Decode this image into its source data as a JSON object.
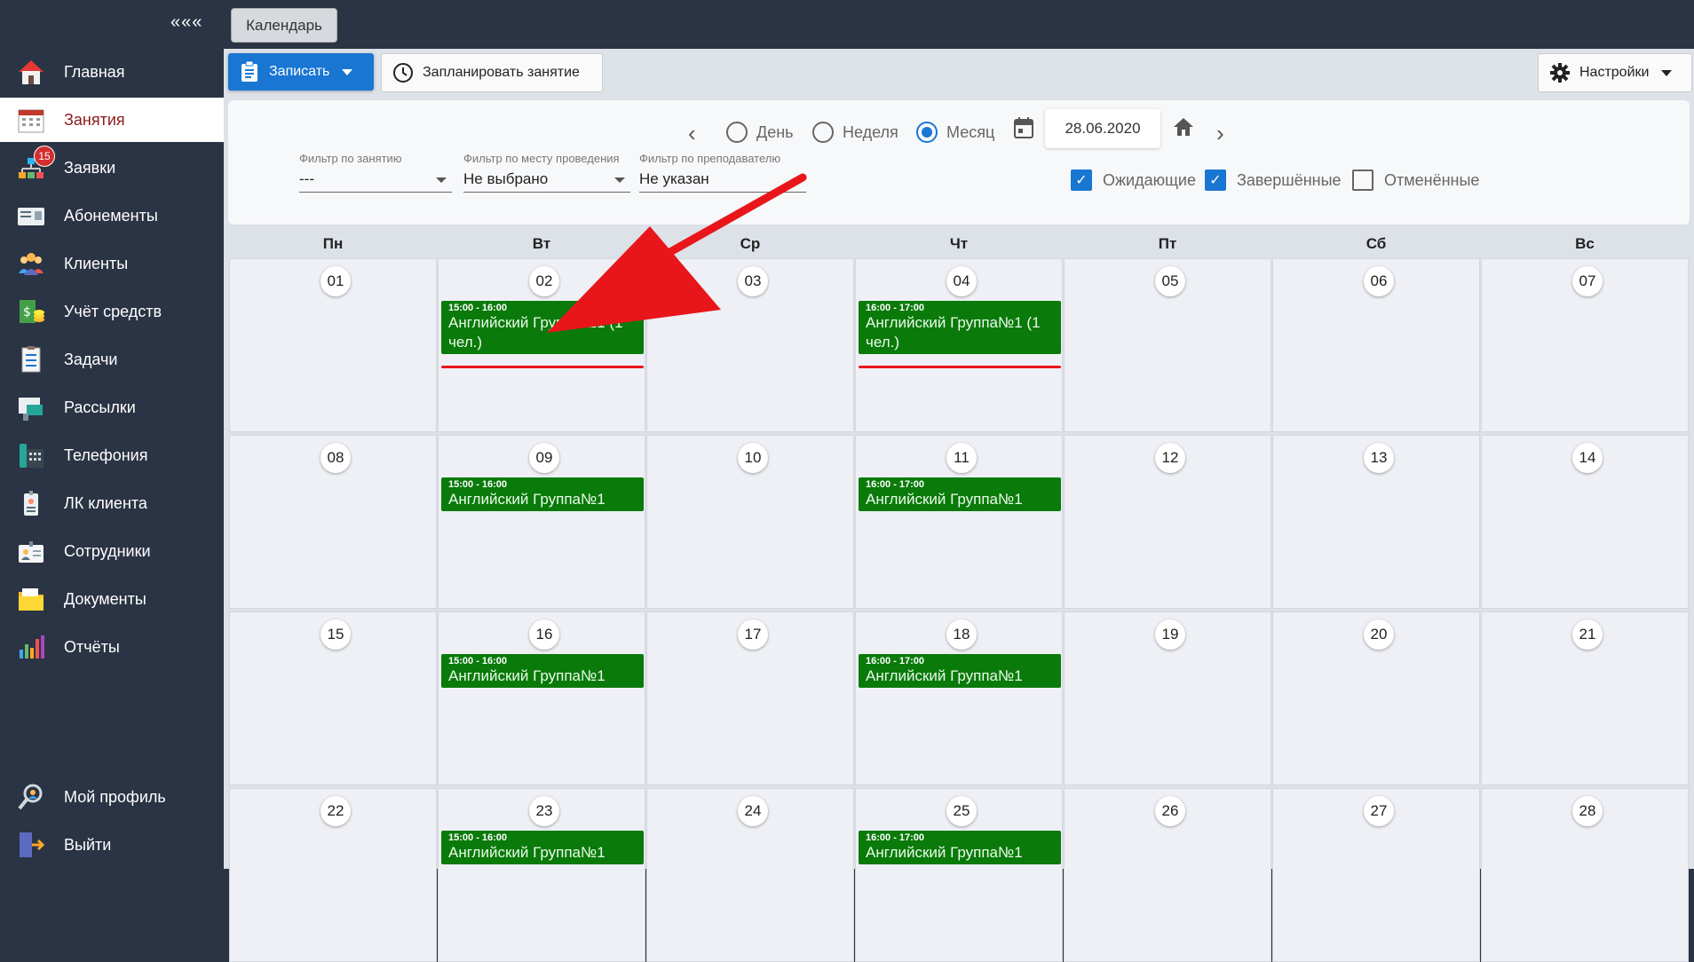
{
  "sidebar": {
    "collapse_label": "«««",
    "items": [
      {
        "label": "Главная",
        "icon": "home-icon"
      },
      {
        "label": "Занятия",
        "icon": "calendar-icon",
        "active": true
      },
      {
        "label": "Заявки",
        "icon": "requests-icon",
        "badge": "15"
      },
      {
        "label": "Абонементы",
        "icon": "subscription-card-icon"
      },
      {
        "label": "Клиенты",
        "icon": "clients-icon"
      },
      {
        "label": "Учёт средств",
        "icon": "money-icon"
      },
      {
        "label": "Задачи",
        "icon": "tasks-icon"
      },
      {
        "label": "Рассылки",
        "icon": "mailing-icon"
      },
      {
        "label": "Телефония",
        "icon": "phone-icon"
      },
      {
        "label": "ЛК клиента",
        "icon": "client-badge-icon"
      },
      {
        "label": "Сотрудники",
        "icon": "staff-icon"
      },
      {
        "label": "Документы",
        "icon": "documents-icon"
      },
      {
        "label": "Отчёты",
        "icon": "reports-icon"
      }
    ],
    "bottom_items": [
      {
        "label": "Мой профиль",
        "icon": "profile-icon"
      },
      {
        "label": "Выйти",
        "icon": "logout-icon"
      }
    ]
  },
  "topbar": {
    "tab_label": "Календарь"
  },
  "actions": {
    "write_label": "Записать",
    "plan_label": "Запланировать занятие",
    "settings_label": "Настройки"
  },
  "view": {
    "modes": [
      {
        "label": "День",
        "selected": false
      },
      {
        "label": "Неделя",
        "selected": false
      },
      {
        "label": "Месяц",
        "selected": true
      }
    ],
    "date": "28.06.2020"
  },
  "filters": [
    {
      "label": "Фильтр по занятию",
      "value": "---"
    },
    {
      "label": "Фильтр по месту проведения",
      "value": "Не выбрано"
    },
    {
      "label": "Фильтр по преподавателю",
      "value": "Не указан"
    }
  ],
  "status_checks": [
    {
      "label": "Ожидающие",
      "checked": true
    },
    {
      "label": "Завершённые",
      "checked": true
    },
    {
      "label": "Отменённые",
      "checked": false
    }
  ],
  "calendar": {
    "weekdays": [
      "Пн",
      "Вт",
      "Ср",
      "Чт",
      "Пт",
      "Сб",
      "Вс"
    ],
    "weeks": [
      [
        "01",
        "02",
        "03",
        "04",
        "05",
        "06",
        "07"
      ],
      [
        "08",
        "09",
        "10",
        "11",
        "12",
        "13",
        "14"
      ],
      [
        "15",
        "16",
        "17",
        "18",
        "19",
        "20",
        "21"
      ],
      [
        "22",
        "23",
        "24",
        "25",
        "26",
        "27",
        "28"
      ]
    ],
    "events": [
      {
        "week": 0,
        "day": 1,
        "time": "15:00 - 16:00",
        "title": "Английский Группа№1 (1 чел.)"
      },
      {
        "week": 0,
        "day": 3,
        "time": "16:00 - 17:00",
        "title": "Английский Группа№1 (1 чел.)"
      },
      {
        "week": 1,
        "day": 1,
        "time": "15:00 - 16:00",
        "title": "Английский Группа№1"
      },
      {
        "week": 1,
        "day": 3,
        "time": "16:00 - 17:00",
        "title": "Английский Группа№1"
      },
      {
        "week": 2,
        "day": 1,
        "time": "15:00 - 16:00",
        "title": "Английский Группа№1"
      },
      {
        "week": 2,
        "day": 3,
        "time": "16:00 - 17:00",
        "title": "Английский Группа№1"
      },
      {
        "week": 3,
        "day": 1,
        "time": "15:00 - 16:00",
        "title": "Английский Группа№1"
      },
      {
        "week": 3,
        "day": 3,
        "time": "16:00 - 17:00",
        "title": "Английский Группа№1"
      }
    ]
  },
  "colors": {
    "sidebar_bg": "#2b3444",
    "accent": "#1976d2",
    "event_green": "#0a7a0a",
    "annotation_red": "#e8161b"
  }
}
